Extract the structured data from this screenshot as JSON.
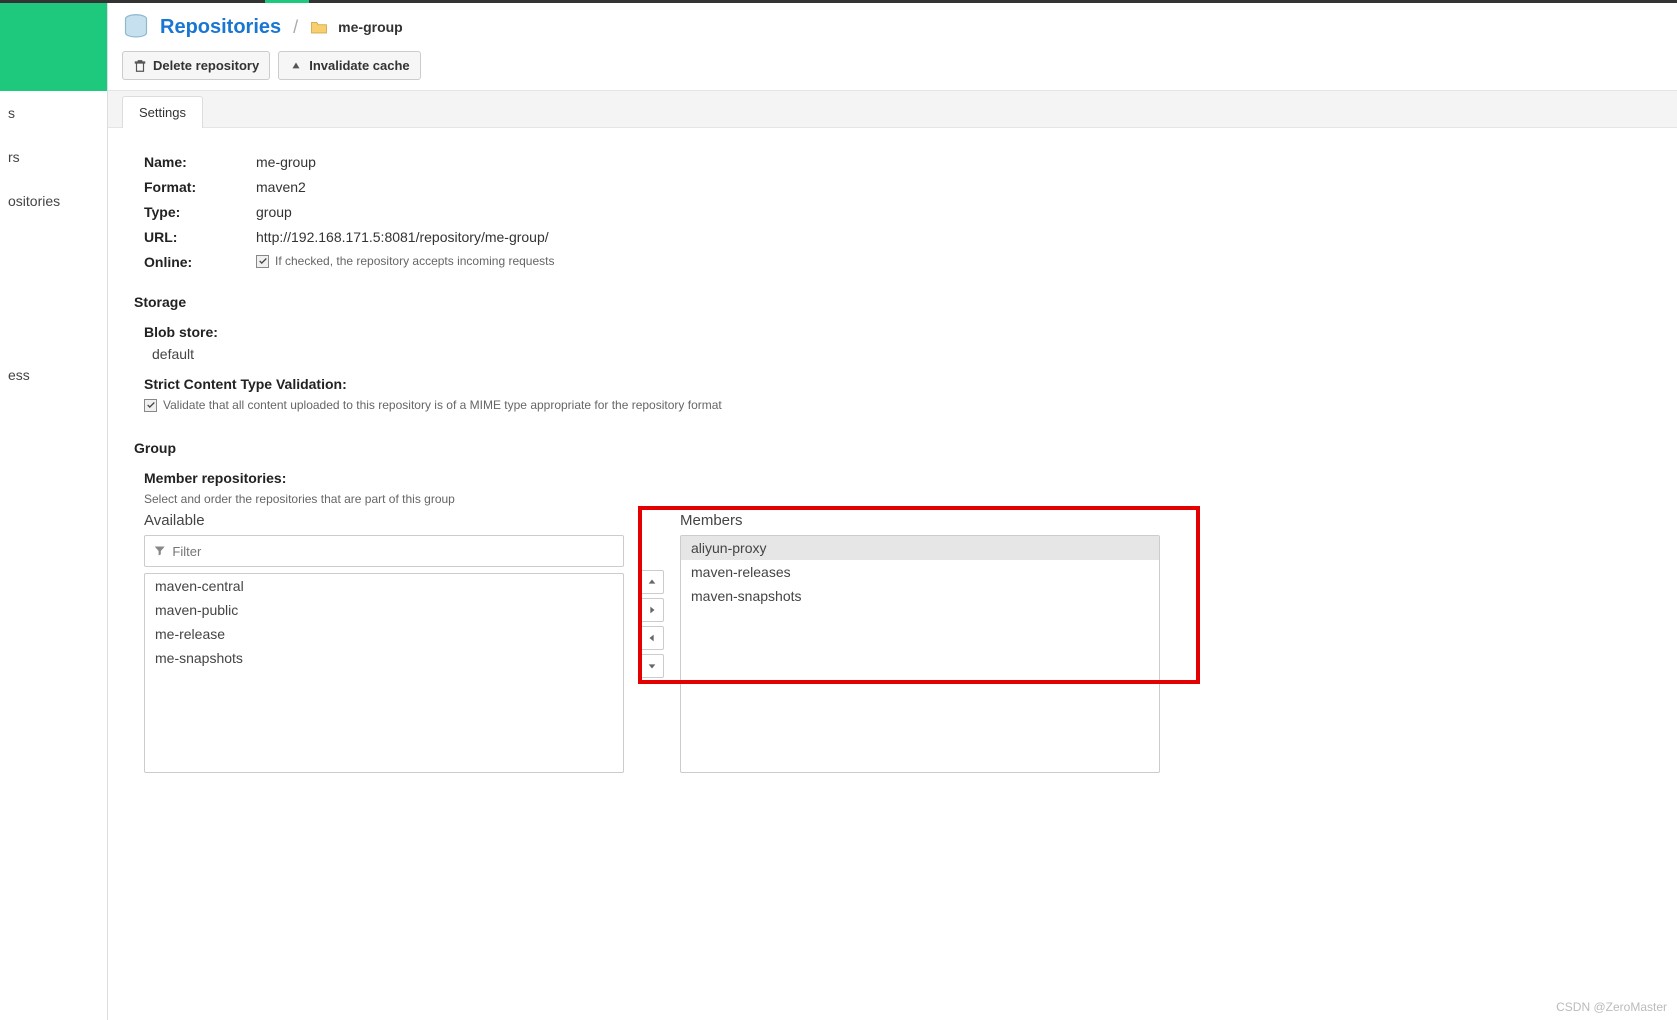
{
  "breadcrumb": {
    "title": "Repositories",
    "current": "me-group"
  },
  "toolbar": {
    "delete_label": "Delete repository",
    "invalidate_label": "Invalidate cache"
  },
  "tabs": {
    "settings": "Settings"
  },
  "fields": {
    "name_label": "Name:",
    "name_value": "me-group",
    "format_label": "Format:",
    "format_value": "maven2",
    "type_label": "Type:",
    "type_value": "group",
    "url_label": "URL:",
    "url_value": "http://192.168.171.5:8081/repository/me-group/",
    "online_label": "Online:",
    "online_help": "If checked, the repository accepts incoming requests"
  },
  "storage": {
    "header": "Storage",
    "blob_label": "Blob store:",
    "blob_value": "default",
    "strict_label": "Strict Content Type Validation:",
    "strict_help": "Validate that all content uploaded to this repository is of a MIME type appropriate for the repository format"
  },
  "group": {
    "header": "Group",
    "member_label": "Member repositories:",
    "member_desc": "Select and order the repositories that are part of this group",
    "available_label": "Available",
    "members_label": "Members",
    "filter_placeholder": "Filter",
    "available_items": [
      "maven-central",
      "maven-public",
      "me-release",
      "me-snapshots"
    ],
    "member_items": [
      "aliyun-proxy",
      "maven-releases",
      "maven-snapshots"
    ]
  },
  "sidebar": {
    "items": [
      "s",
      "rs",
      "ositories",
      "",
      "",
      "",
      "ess"
    ]
  },
  "watermark": "CSDN @ZeroMaster"
}
